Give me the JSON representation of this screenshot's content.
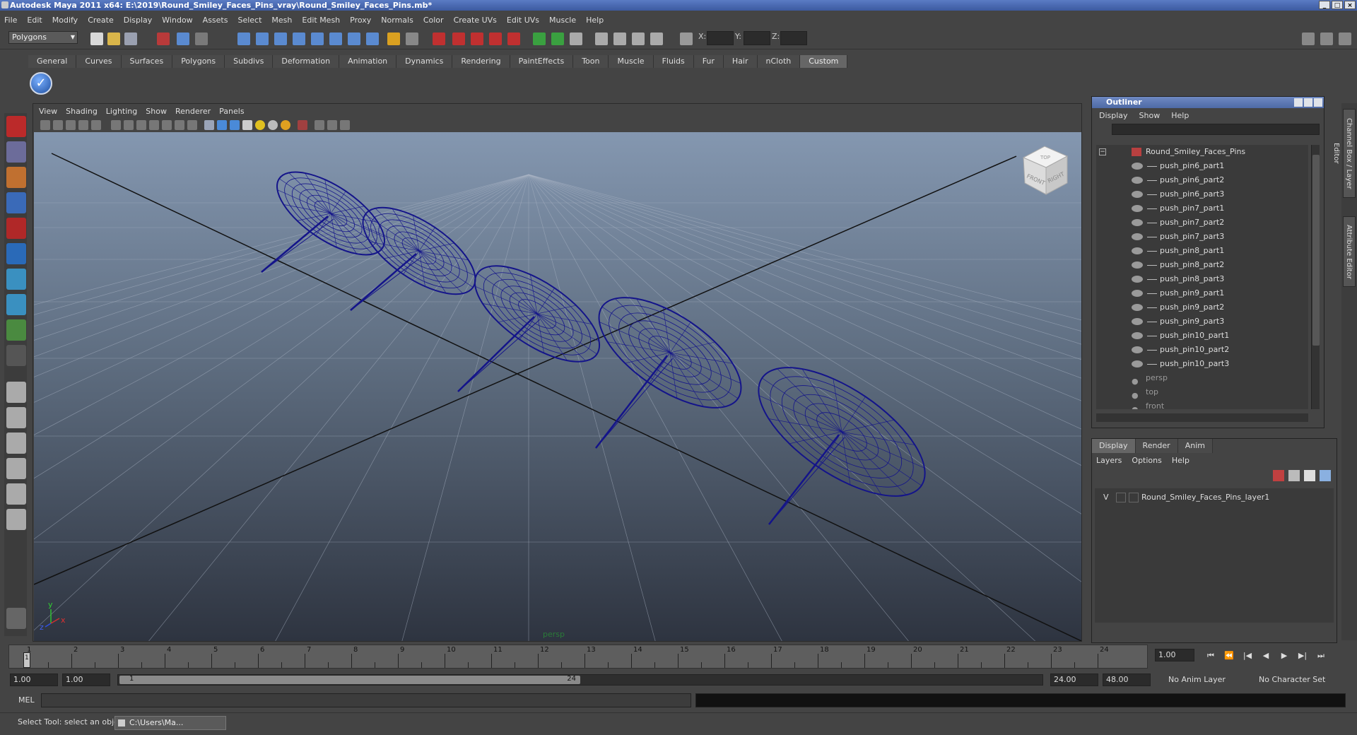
{
  "window": {
    "title": "Autodesk Maya 2011 x64: E:\\2019\\Round_Smiley_Faces_Pins_vray\\Round_Smiley_Faces_Pins.mb*",
    "controls": [
      "_",
      "□",
      "×"
    ]
  },
  "menubar": [
    "File",
    "Edit",
    "Modify",
    "Create",
    "Display",
    "Window",
    "Assets",
    "Select",
    "Mesh",
    "Edit Mesh",
    "Proxy",
    "Normals",
    "Color",
    "Create UVs",
    "Edit UVs",
    "Muscle",
    "Help"
  ],
  "statusline": {
    "mode": "Polygons",
    "x_label": "X:",
    "y_label": "Y:",
    "z_label": "Z:"
  },
  "shelf": {
    "tabs": [
      "General",
      "Curves",
      "Surfaces",
      "Polygons",
      "Subdivs",
      "Deformation",
      "Animation",
      "Dynamics",
      "Rendering",
      "PaintEffects",
      "Toon",
      "Muscle",
      "Fluids",
      "Fur",
      "Hair",
      "nCloth",
      "Custom"
    ],
    "active_tab": "Custom"
  },
  "viewport": {
    "menu": [
      "View",
      "Shading",
      "Lighting",
      "Show",
      "Renderer",
      "Panels"
    ],
    "camera_label": "persp",
    "viewcube": {
      "front": "FRONT",
      "right": "RIGHT",
      "top": "TOP"
    },
    "axis": {
      "x": "x",
      "y": "y",
      "z": "z"
    }
  },
  "outliner": {
    "title": "Outliner",
    "menu": [
      "Display",
      "Show",
      "Help"
    ],
    "root": "Round_Smiley_Faces_Pins",
    "items": [
      "push_pin6_part1",
      "push_pin6_part2",
      "push_pin6_part3",
      "push_pin7_part1",
      "push_pin7_part2",
      "push_pin7_part3",
      "push_pin8_part1",
      "push_pin8_part2",
      "push_pin8_part3",
      "push_pin9_part1",
      "push_pin9_part2",
      "push_pin9_part3",
      "push_pin10_part1",
      "push_pin10_part2",
      "push_pin10_part3"
    ],
    "cameras": [
      "persp",
      "top",
      "front"
    ],
    "collapse_symbol": "−"
  },
  "layers": {
    "tabs": [
      "Display",
      "Render",
      "Anim"
    ],
    "active_tab": "Display",
    "menu": [
      "Layers",
      "Options",
      "Help"
    ],
    "rows": [
      {
        "visible": "V",
        "name": "Round_Smiley_Faces_Pins_layer1"
      }
    ]
  },
  "side_tabs": [
    "Channel Box / Layer Editor",
    "Attribute Editor"
  ],
  "timeslider": {
    "ticks": [
      "1",
      "2",
      "3",
      "4",
      "5",
      "6",
      "7",
      "8",
      "9",
      "10",
      "11",
      "12",
      "13",
      "14",
      "15",
      "16",
      "17",
      "18",
      "19",
      "20",
      "21",
      "22",
      "23",
      "24"
    ],
    "marker": "1",
    "current_frame": "1.00",
    "controls": [
      "⏮",
      "⏪",
      "|◀",
      "◀",
      "▶",
      "▶|",
      "⏭"
    ]
  },
  "range": {
    "start": "1.00",
    "playback_start": "1.00",
    "slider_start": "1",
    "slider_end": "24",
    "playback_end": "24.00",
    "end": "48.00",
    "anim_layer": "No Anim Layer",
    "character_set": "No Character Set"
  },
  "cmdline": {
    "label": "MEL"
  },
  "helpline": {
    "text": "Select Tool: select an object",
    "task": "C:\\Users\\Ma..."
  },
  "colors": {
    "wire": "#14148a",
    "grid": "#aab4c4",
    "title_blue": "#3c5aa0"
  },
  "icons": [
    "select-arrow-icon",
    "lasso-icon",
    "paint-icon",
    "cone-icon",
    "sphere-icon",
    "cube-icon",
    "move-icon",
    "rotate-icon",
    "scale-icon",
    "viewcube-icon",
    "eye-icon",
    "camera-icon",
    "checkmark-shelf-icon"
  ]
}
